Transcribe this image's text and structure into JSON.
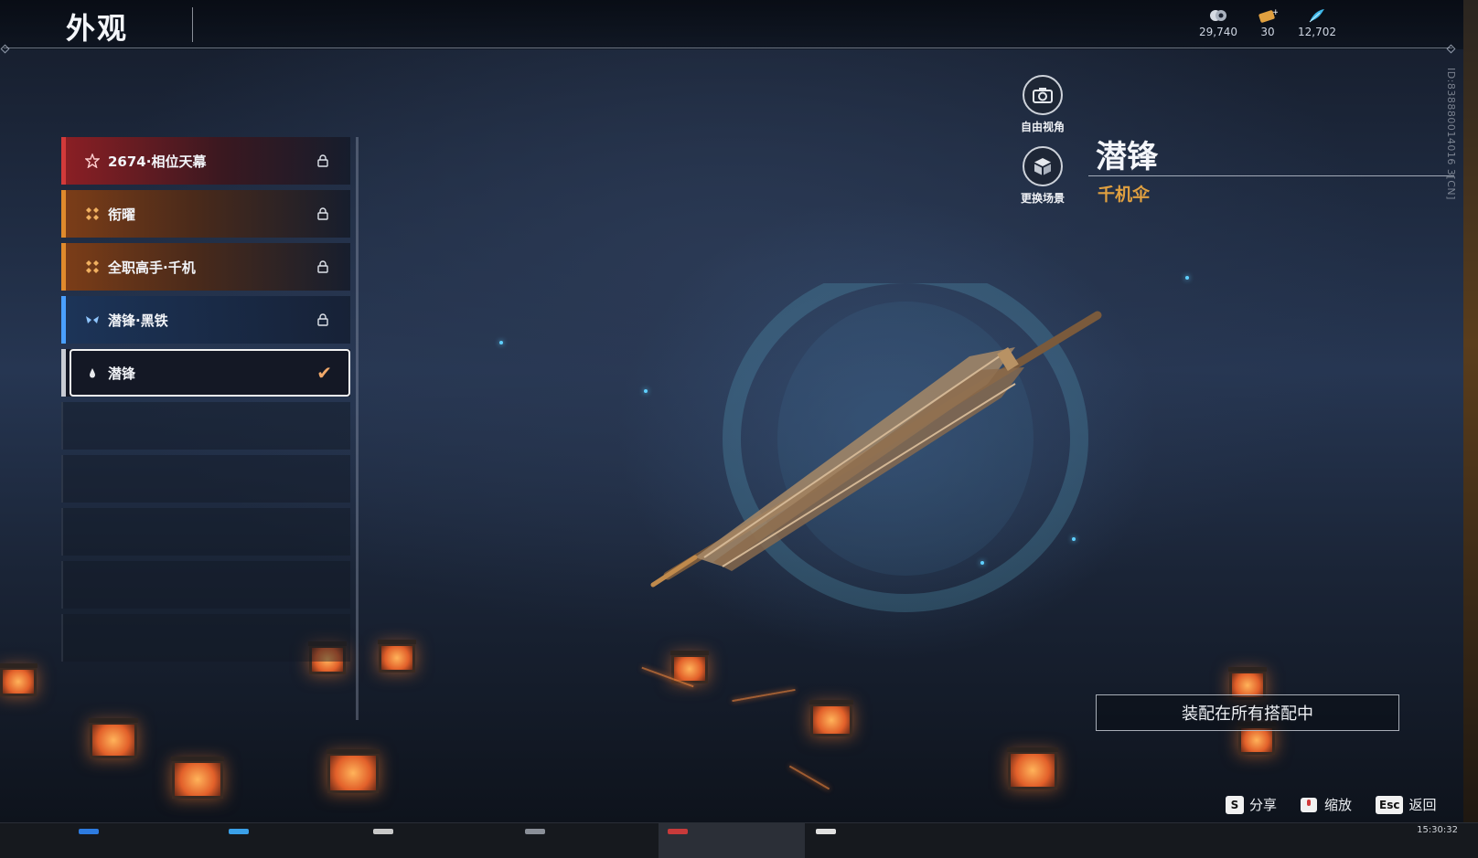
{
  "header": {
    "title": "外观"
  },
  "currencies": [
    {
      "icon": "coin-icon",
      "value": "29,740"
    },
    {
      "icon": "ticket-icon",
      "value": "30"
    },
    {
      "icon": "feather-icon",
      "value": "12,702"
    }
  ],
  "skins": [
    {
      "label": "2674·相位天幕",
      "rarity": "red",
      "icon": "star-icon",
      "state": "locked"
    },
    {
      "label": "衔曜",
      "rarity": "orange",
      "icon": "quad-diamond-icon",
      "state": "locked"
    },
    {
      "label": "全职高手·千机",
      "rarity": "orange",
      "icon": "quad-diamond-icon",
      "state": "locked"
    },
    {
      "label": "潜锋·黑铁",
      "rarity": "blue",
      "icon": "wings-icon",
      "state": "locked"
    },
    {
      "label": "潜锋",
      "rarity": "white",
      "icon": "drop-icon",
      "state": "equipped"
    }
  ],
  "view_buttons": {
    "free_camera": "自由视角",
    "change_scene": "更换场景"
  },
  "weapon": {
    "name": "潜锋",
    "type": "千机伞"
  },
  "player_id": "ID:838880014016 3[CN]",
  "equip_all_label": "装配在所有搭配中",
  "hints": [
    {
      "key": "S",
      "label": "分享"
    },
    {
      "key": "",
      "label": "缩放"
    },
    {
      "key": "Esc",
      "label": "返回"
    }
  ],
  "taskbar": {
    "clock": "15:30:32"
  },
  "colors": {
    "accent_gold": "#e0a040",
    "rarity_red": "#d23a3a",
    "rarity_orange": "#e08a2c",
    "rarity_blue": "#4aa0ff"
  }
}
